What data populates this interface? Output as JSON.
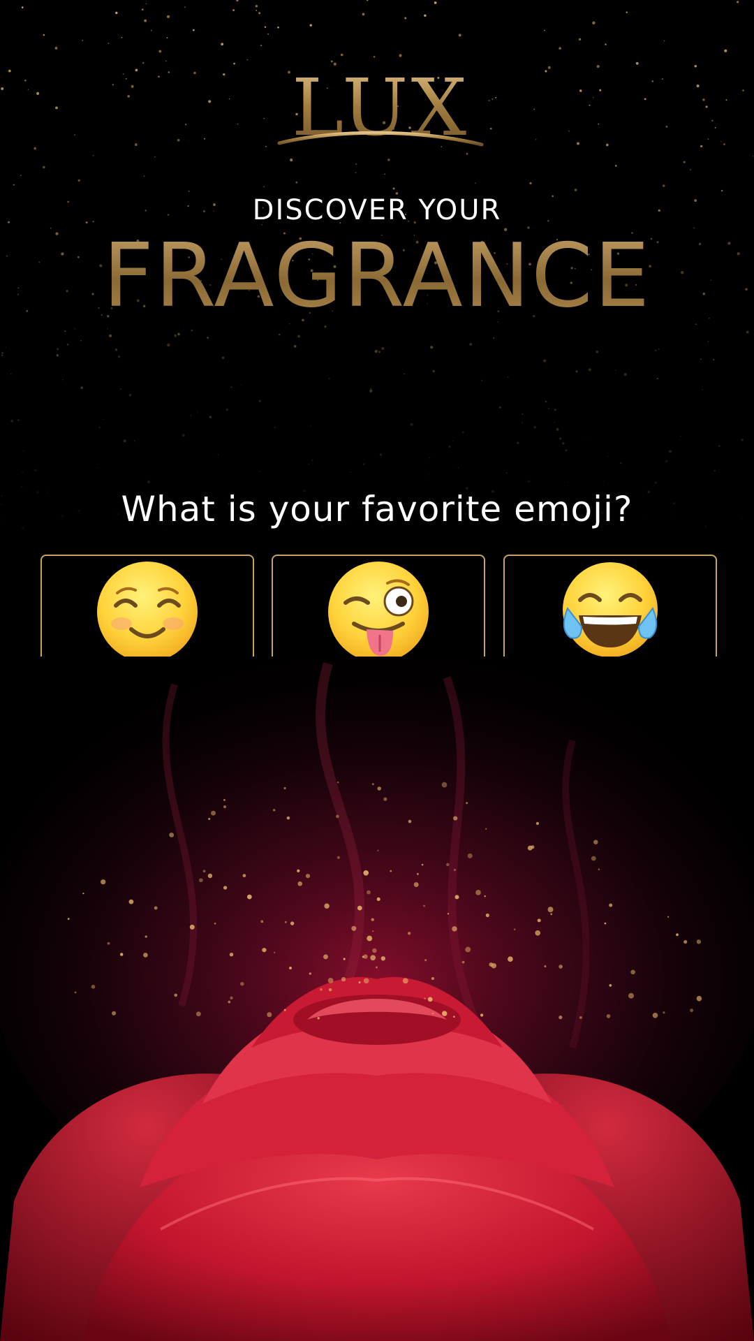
{
  "brand": {
    "logo_text": "LUX"
  },
  "header": {
    "subtitle": "DISCOVER YOUR",
    "title": "FRAGRANCE"
  },
  "quiz": {
    "question": "What is your favorite emoji?",
    "options": [
      {
        "icon": "smiling-blush-face-icon"
      },
      {
        "icon": "winking-tongue-face-icon"
      },
      {
        "icon": "tears-of-joy-face-icon"
      }
    ]
  },
  "colors": {
    "background": "#000000",
    "gold": "#b08a4e",
    "option_border": "#c7a45f",
    "rose": "#c8102e"
  }
}
